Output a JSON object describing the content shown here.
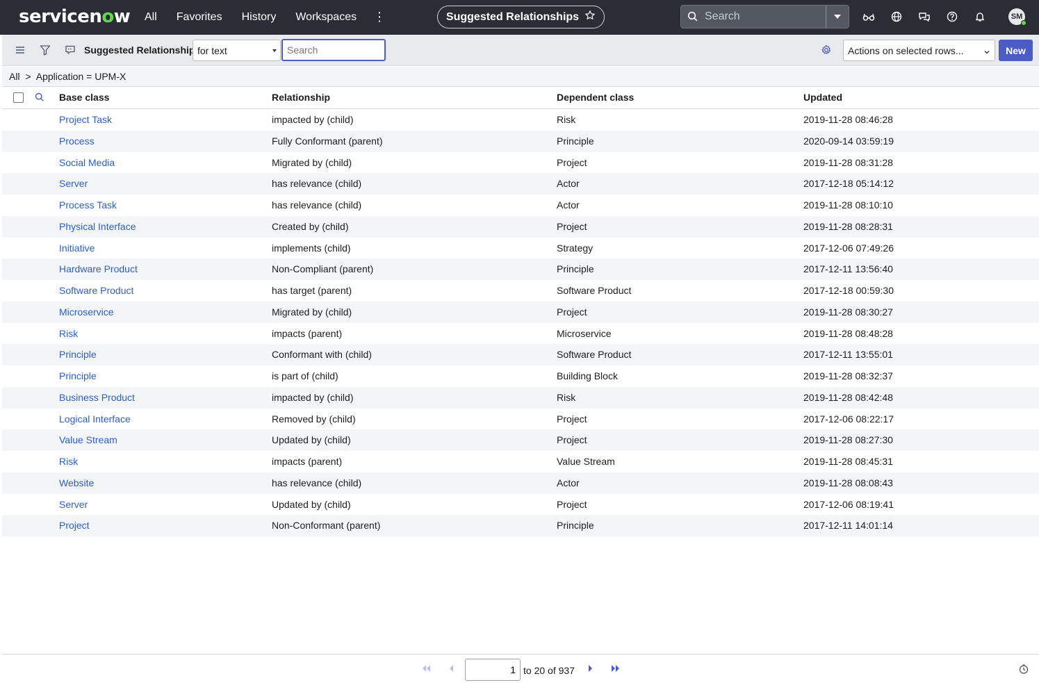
{
  "topnav": {
    "logo_text_a": "servicen",
    "logo_text_b": "w",
    "menu": [
      "All",
      "Favorites",
      "History",
      "Workspaces"
    ],
    "more": "⋮",
    "context_title": "Suggested Relationships",
    "search_placeholder": "Search",
    "avatar_initials": "SM"
  },
  "toolbar": {
    "list_title": "Suggested Relationships",
    "for_value": "for text",
    "search_placeholder": "Search",
    "actions_value": "Actions on selected rows...",
    "new_label": "New"
  },
  "breadcrumb": {
    "root": "All",
    "sep": ">",
    "filter": "Application = UPM-X"
  },
  "table": {
    "headers": [
      "Base class",
      "Relationship",
      "Dependent class",
      "Updated"
    ],
    "rows": [
      [
        "Project Task",
        "impacted by (child)",
        "Risk",
        "2019-11-28 08:46:28"
      ],
      [
        "Process",
        "Fully Conformant (parent)",
        "Principle",
        "2020-09-14 03:59:19"
      ],
      [
        "Social Media",
        "Migrated by (child)",
        "Project",
        "2019-11-28 08:31:28"
      ],
      [
        "Server",
        "has relevance (child)",
        "Actor",
        "2017-12-18 05:14:12"
      ],
      [
        "Process Task",
        "has relevance (child)",
        "Actor",
        "2019-11-28 08:10:10"
      ],
      [
        "Physical Interface",
        "Created by (child)",
        "Project",
        "2019-11-28 08:28:31"
      ],
      [
        "Initiative",
        "implements (child)",
        "Strategy",
        "2017-12-06 07:49:26"
      ],
      [
        "Hardware Product",
        "Non-Compliant (parent)",
        "Principle",
        "2017-12-11 13:56:40"
      ],
      [
        "Software Product",
        "has target (parent)",
        "Software Product",
        "2017-12-18 00:59:30"
      ],
      [
        "Microservice",
        "Migrated by (child)",
        "Project",
        "2019-11-28 08:30:27"
      ],
      [
        "Risk",
        "impacts (parent)",
        "Microservice",
        "2019-11-28 08:48:28"
      ],
      [
        "Principle",
        "Conformant with (child)",
        "Software Product",
        "2017-12-11 13:55:01"
      ],
      [
        "Principle",
        "is part of (child)",
        "Building Block",
        "2019-11-28 08:32:37"
      ],
      [
        "Business Product",
        "impacted by (child)",
        "Risk",
        "2019-11-28 08:42:48"
      ],
      [
        "Logical Interface",
        "Removed by (child)",
        "Project",
        "2017-12-06 08:22:17"
      ],
      [
        "Value Stream",
        "Updated by (child)",
        "Project",
        "2019-11-28 08:27:30"
      ],
      [
        "Risk",
        "impacts (parent)",
        "Value Stream",
        "2019-11-28 08:45:31"
      ],
      [
        "Website",
        "has relevance (child)",
        "Actor",
        "2019-11-28 08:08:43"
      ],
      [
        "Server",
        "Updated by (child)",
        "Project",
        "2017-12-06 08:19:41"
      ],
      [
        "Project",
        "Non-Conformant (parent)",
        "Principle",
        "2017-12-11 14:01:14"
      ]
    ]
  },
  "pagination": {
    "current": "1",
    "range_text": "to 20 of 937"
  },
  "colors": {
    "nav_bg": "#2a2d35",
    "accent": "#4b5cc4",
    "link": "#2b5fc7",
    "logo_green": "#62d84e"
  }
}
